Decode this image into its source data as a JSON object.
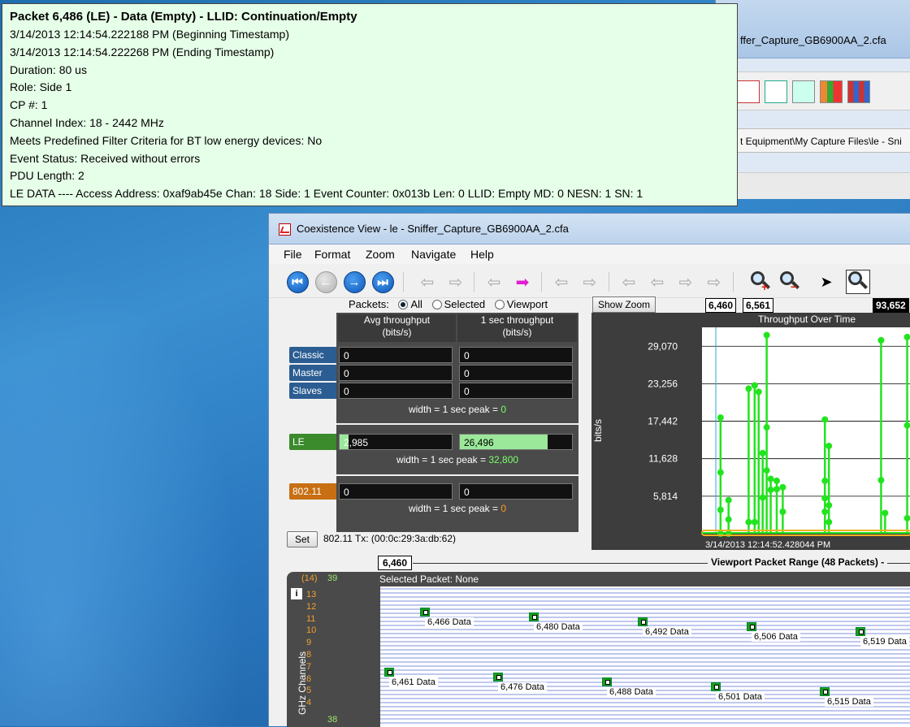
{
  "tooltip": {
    "title": "Packet 6,486 (LE) - Data (Empty) - LLID: Continuation/Empty",
    "lines": [
      "3/14/2013 12:14:54.222188 PM (Beginning Timestamp)",
      "3/14/2013 12:14:54.222268 PM (Ending Timestamp)",
      "Duration: 80 us",
      "Role: Side 1",
      "CP #: 1",
      "Channel Index: 18 - 2442 MHz",
      "Meets Predefined Filter Criteria for BT low energy devices: No",
      "Event Status: Received without errors",
      "PDU Length: 2",
      "LE DATA ---- Access Address: 0xaf9ab45e Chan: 18  Side: 1 Event Counter: 0x013b Len: 0 LLID: Empty MD: 0 NESN: 1 SN: 1"
    ]
  },
  "back_window": {
    "title": "ffer_Capture_GB6900AA_2.cfa",
    "path": "t Equipment\\My Capture Files\\le - Sni"
  },
  "window": {
    "title": "Coexistence View - le - Sniffer_Capture_GB6900AA_2.cfa"
  },
  "menu": [
    "File",
    "Format",
    "Zoom",
    "Navigate",
    "Help"
  ],
  "packets_filter": {
    "label": "Packets:",
    "options": [
      "All",
      "Selected",
      "Viewport"
    ],
    "selected": "All"
  },
  "throughput": {
    "headers": [
      "Avg throughput\n(bits/s)",
      "1 sec throughput\n(bits/s)"
    ],
    "classic_rows": [
      {
        "label": "Classic",
        "avg": "0",
        "sec": "0"
      },
      {
        "label": "Master",
        "avg": "0",
        "sec": "0"
      },
      {
        "label": "Slaves",
        "avg": "0",
        "sec": "0"
      }
    ],
    "classic_note": "width = 1 sec peak = ",
    "classic_peak": "0",
    "le": {
      "label": "LE",
      "avg": "2,985",
      "sec": "26,496",
      "avg_fill": 0.08,
      "sec_fill": 0.78
    },
    "le_note": "width = 1 sec peak = ",
    "le_peak": "32,800",
    "wifi": {
      "label": "802.11",
      "avg": "0",
      "sec": "0"
    },
    "wifi_note": "width = 1 sec peak = ",
    "wifi_peak": "0"
  },
  "set_button": "Set",
  "tx_text": "802.11 Tx: (00:0c:29:3a:db:62)",
  "show_zoom": "Show Zoom",
  "range_start": "6,460",
  "range_end": "6,561",
  "range_total": "93,652",
  "viewport": {
    "start": "6,460",
    "label": "Viewport Packet Range (48 Packets) -"
  },
  "chart_data": {
    "type": "line",
    "title": "Throughput Over Time",
    "ylabel": "bits/s",
    "yticks": [
      "29,070",
      "23,256",
      "17,442",
      "11,628",
      "5,814"
    ],
    "ylim": [
      0,
      32000
    ],
    "x_label_text": "3/14/2013 12:14:52.428044 PM",
    "series": [
      {
        "color": "#22e41e",
        "spikes": [
          {
            "x": 0.06,
            "tops": [
              18000,
              9500,
              3700,
              0
            ]
          },
          {
            "x": 0.1,
            "tops": [
              5200,
              2200,
              0
            ]
          },
          {
            "x": 0.2,
            "tops": [
              22500,
              1800
            ]
          },
          {
            "x": 0.23,
            "tops": [
              23000,
              1800
            ]
          },
          {
            "x": 0.25,
            "tops": [
              22000
            ]
          },
          {
            "x": 0.27,
            "tops": [
              12500,
              5600
            ]
          },
          {
            "x": 0.29,
            "tops": [
              30800,
              16500,
              9800
            ]
          },
          {
            "x": 0.31,
            "tops": [
              8500,
              6800
            ]
          },
          {
            "x": 0.34,
            "tops": [
              8200,
              6900
            ]
          },
          {
            "x": 0.37,
            "tops": [
              7200,
              3400
            ]
          },
          {
            "x": 0.58,
            "tops": [
              17700,
              8200,
              5500,
              3400
            ]
          },
          {
            "x": 0.6,
            "tops": [
              13600,
              4400,
              1800
            ]
          },
          {
            "x": 0.86,
            "tops": [
              30000,
              8300
            ]
          },
          {
            "x": 0.88,
            "tops": [
              3200
            ]
          },
          {
            "x": 0.99,
            "tops": [
              30500,
              16800,
              2400
            ]
          }
        ]
      }
    ]
  },
  "channels": {
    "selected_text": "Selected Packet: None",
    "axis_label": "GHz Channels",
    "info_icon": "i",
    "mhz_label": "(14)",
    "orange_nums": [
      "13",
      "12",
      "11",
      "10",
      "9",
      "8",
      "7",
      "6",
      "5",
      "4"
    ],
    "green_nums": [
      "39",
      "38"
    ],
    "packets": [
      {
        "label": "6,466 Data",
        "col": 0,
        "row": 0
      },
      {
        "label": "6,480 Data",
        "col": 1,
        "row": 0
      },
      {
        "label": "6,492 Data",
        "col": 2,
        "row": 0
      },
      {
        "label": "6,506 Data",
        "col": 3,
        "row": 0
      },
      {
        "label": "6,519 Data",
        "col": 4,
        "row": 0
      },
      {
        "label": "6,461 Data",
        "col": 0,
        "row": 1
      },
      {
        "label": "6,476 Data",
        "col": 1,
        "row": 1
      },
      {
        "label": "6,488 Data",
        "col": 2,
        "row": 1
      },
      {
        "label": "6,501 Data",
        "col": 3,
        "row": 1
      },
      {
        "label": "6,515 Data",
        "col": 4,
        "row": 1
      }
    ]
  }
}
